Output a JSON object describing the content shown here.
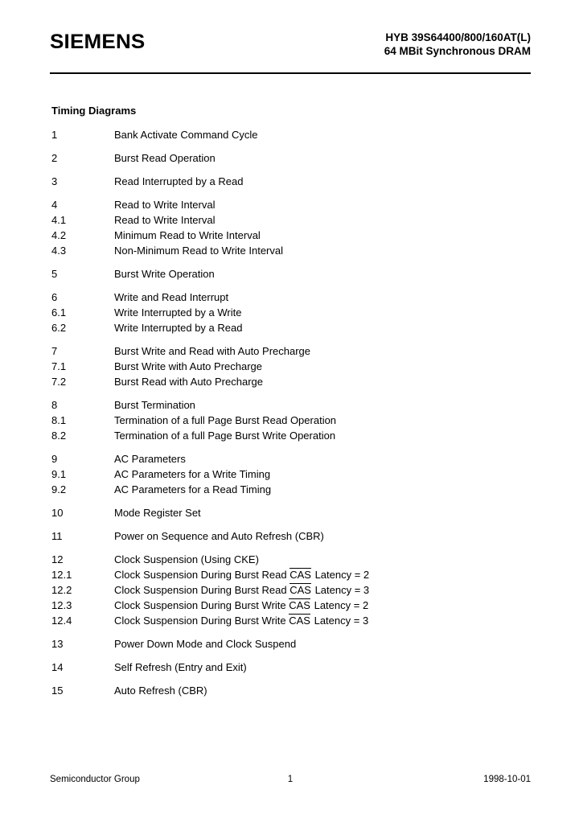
{
  "header": {
    "brand": "SIEMENS",
    "part_number": "HYB 39S64400/800/160AT(L)",
    "product_description": "64 MBit Synchronous DRAM"
  },
  "section_title": "Timing Diagrams",
  "toc_groups": [
    {
      "rows": [
        {
          "number": "1",
          "label": "Bank Activate Command Cycle"
        }
      ]
    },
    {
      "rows": [
        {
          "number": "2",
          "label": "Burst Read Operation"
        }
      ]
    },
    {
      "rows": [
        {
          "number": "3",
          "label": "Read Interrupted by a Read"
        }
      ]
    },
    {
      "rows": [
        {
          "number": "4",
          "label": "Read to Write Interval"
        },
        {
          "number": "4.1",
          "label": "Read to Write Interval"
        },
        {
          "number": "4.2",
          "label": "Minimum Read to Write Interval"
        },
        {
          "number": "4.3",
          "label": "Non-Minimum Read to Write Interval"
        }
      ]
    },
    {
      "rows": [
        {
          "number": "5",
          "label": "Burst Write Operation"
        }
      ]
    },
    {
      "rows": [
        {
          "number": "6",
          "label": "Write and Read Interrupt"
        },
        {
          "number": "6.1",
          "label": "Write Interrupted by a Write"
        },
        {
          "number": "6.2",
          "label": "Write Interrupted by a Read"
        }
      ]
    },
    {
      "rows": [
        {
          "number": "7",
          "label": "Burst Write and Read with Auto Precharge"
        },
        {
          "number": "7.1",
          "label": "Burst Write with Auto Precharge"
        },
        {
          "number": "7.2",
          "label": "Burst Read with Auto Precharge"
        }
      ]
    },
    {
      "rows": [
        {
          "number": "8",
          "label": "Burst Termination"
        },
        {
          "number": "8.1",
          "label": "Termination of a full Page Burst Read Operation"
        },
        {
          "number": "8.2",
          "label": "Termination of a full Page Burst Write Operation"
        }
      ]
    },
    {
      "rows": [
        {
          "number": "9",
          "label": "AC Parameters"
        },
        {
          "number": "9.1",
          "label": "AC Parameters for a Write Timing"
        },
        {
          "number": "9.2",
          "label": "AC Parameters for a Read Timing"
        }
      ]
    },
    {
      "rows": [
        {
          "number": "10",
          "label": "Mode Register Set"
        }
      ]
    },
    {
      "rows": [
        {
          "number": "11",
          "label": "Power on Sequence and Auto Refresh (CBR)"
        }
      ]
    },
    {
      "rows": [
        {
          "number": "12",
          "label": "Clock Suspension (Using CKE)"
        },
        {
          "number": "12.1",
          "label_prefix": "Clock Suspension During Burst Read ",
          "overline": "CAS",
          "label_suffix": " Latency = 2"
        },
        {
          "number": "12.2",
          "label_prefix": "Clock Suspension During Burst Read ",
          "overline": "CAS",
          "label_suffix": " Latency = 3"
        },
        {
          "number": "12.3",
          "label_prefix": "Clock Suspension During Burst Write ",
          "overline": "CAS",
          "label_suffix": " Latency = 2"
        },
        {
          "number": "12.4",
          "label_prefix": "Clock Suspension During Burst Write ",
          "overline": "CAS",
          "label_suffix": " Latency = 3"
        }
      ]
    },
    {
      "rows": [
        {
          "number": "13",
          "label": "Power Down Mode and Clock Suspend"
        }
      ]
    },
    {
      "rows": [
        {
          "number": "14",
          "label": "Self Refresh (Entry and Exit)"
        }
      ]
    },
    {
      "rows": [
        {
          "number": "15",
          "label": "Auto Refresh (CBR)"
        }
      ]
    }
  ],
  "footer": {
    "left": "Semiconductor Group",
    "page_number": "1",
    "date": "1998-10-01"
  }
}
